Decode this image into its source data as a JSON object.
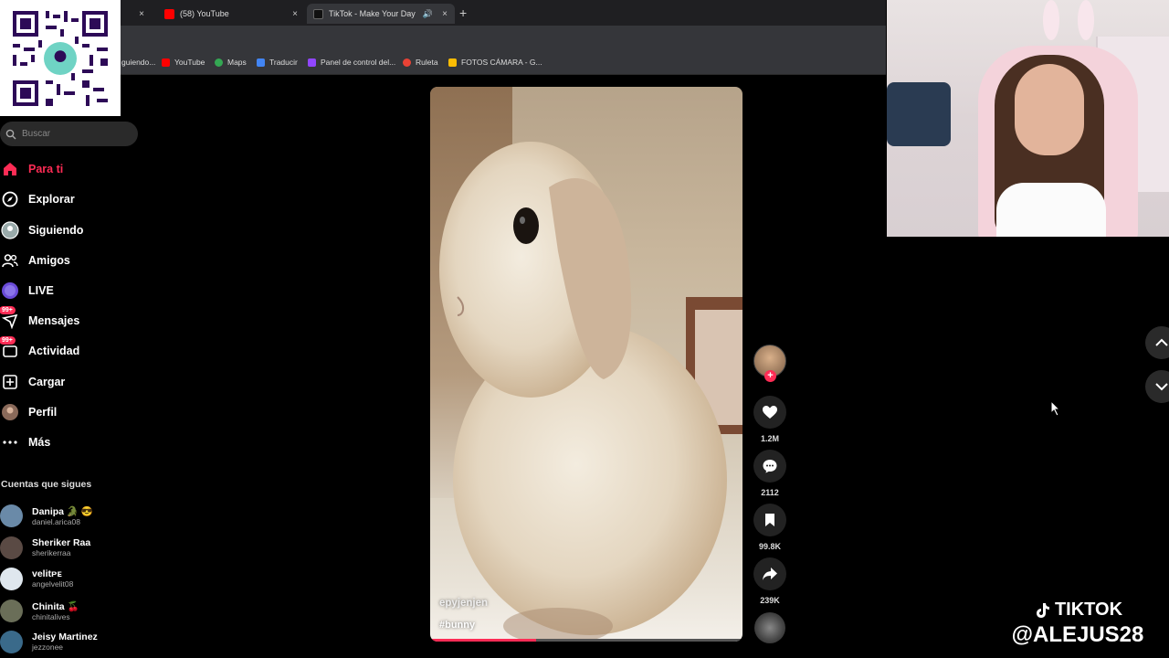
{
  "browser": {
    "tabs": [
      {
        "title": "",
        "close": "×"
      },
      {
        "title": "(58) YouTube",
        "close": "×"
      },
      {
        "title": "TikTok - Make Your Day",
        "close": "×"
      }
    ],
    "new_tab": "+",
    "bookmarks": [
      {
        "label": "guiendo...",
        "color": "#888888"
      },
      {
        "label": "YouTube",
        "color": "#ff0000"
      },
      {
        "label": "Maps",
        "color": "#34a853"
      },
      {
        "label": "Traducir",
        "color": "#4285f4"
      },
      {
        "label": "Panel de control del...",
        "color": "#9146ff"
      },
      {
        "label": "Ruleta",
        "color": "#e94235"
      },
      {
        "label": "FOTOS CÁMARA - G...",
        "color": "#fbbc04"
      }
    ]
  },
  "search": {
    "placeholder": "Buscar"
  },
  "nav": [
    {
      "label": "Para ti",
      "icon": "home-icon",
      "active": true
    },
    {
      "label": "Explorar",
      "icon": "compass-icon"
    },
    {
      "label": "Siguiendo",
      "icon": "following-icon"
    },
    {
      "label": "Amigos",
      "icon": "friends-icon"
    },
    {
      "label": "LIVE",
      "icon": "live-icon"
    },
    {
      "label": "Mensajes",
      "icon": "messages-icon",
      "badge": "99+"
    },
    {
      "label": "Actividad",
      "icon": "activity-icon",
      "badge": "99+"
    },
    {
      "label": "Cargar",
      "icon": "upload-icon"
    },
    {
      "label": "Perfil",
      "icon": "profile-icon"
    },
    {
      "label": "Más",
      "icon": "more-icon"
    }
  ],
  "following": {
    "title": "Cuentas que sigues",
    "accounts": [
      {
        "name": "Danipa 🐊 😎",
        "handle": "daniel.arica08"
      },
      {
        "name": "Sheriker Raa",
        "handle": "sherikerraa"
      },
      {
        "name": "velitᴘᴇ",
        "handle": "angelvelit08"
      },
      {
        "name": "Chinita 🍒",
        "handle": "chinitalives"
      },
      {
        "name": "Jeisy Martinez",
        "handle": "jezzonee"
      }
    ]
  },
  "video": {
    "author": "epyjenjen",
    "hashtag": "#bunny",
    "progress": 0.34
  },
  "actions": {
    "likes": "1.2M",
    "comments": "2112",
    "saves": "99.8K",
    "shares": "239K"
  },
  "overlay": {
    "brand_line1": "TIKTOK",
    "brand_line2": "@ALEJUS28"
  },
  "colors": {
    "accent": "#fe2c55"
  }
}
